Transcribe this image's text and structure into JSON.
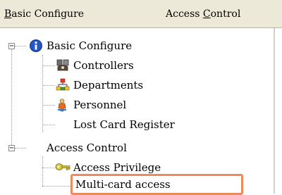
{
  "menubar": {
    "items": [
      {
        "label_underlined": "B",
        "label_rest": "asic Configure"
      },
      {
        "label_plain": "Access ",
        "label_underlined": "C",
        "label_rest": "ontrol"
      }
    ]
  },
  "tree": {
    "nodes": [
      {
        "label": "Basic Configure",
        "icon": "info-icon",
        "expander": "−"
      },
      {
        "label": "Controllers",
        "icon": "controllers-icon"
      },
      {
        "label": "Departments",
        "icon": "departments-icon"
      },
      {
        "label": "Personnel",
        "icon": "personnel-icon"
      },
      {
        "label": "Lost Card Register",
        "icon": "none"
      },
      {
        "label": "Access Control",
        "icon": "none",
        "expander": "−"
      },
      {
        "label": "Access Privilege",
        "icon": "key-icon"
      },
      {
        "label": "Multi-card access",
        "icon": "none",
        "highlighted": true
      }
    ]
  },
  "colors": {
    "highlight": "#f08a5a",
    "menubar_bg": "#ece9d8"
  }
}
